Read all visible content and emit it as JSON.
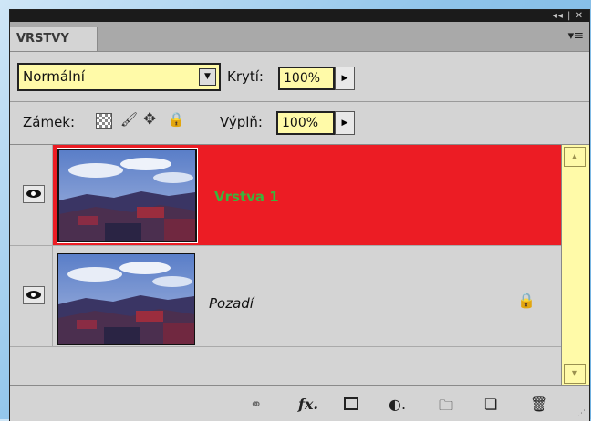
{
  "titlebar": {
    "controls": "◂◂ | ✕"
  },
  "panel": {
    "tab_label": "VRSTVY",
    "menu_icon": "panel-menu-icon"
  },
  "options": {
    "blend_mode": "Normální",
    "opacity_label": "Krytí:",
    "opacity_value": "100%",
    "lock_label": "Zámek:",
    "fill_label": "Výplň:",
    "fill_value": "100%"
  },
  "layers": [
    {
      "name": "Vrstva 1",
      "selected": true,
      "visible": true,
      "locked": false
    },
    {
      "name": "Pozadí",
      "selected": false,
      "visible": true,
      "locked": true
    }
  ],
  "colors": {
    "selected_bg": "#ec1c24",
    "selected_name": "#3cb43c",
    "input_bg": "#fffaa8"
  },
  "bottom_icons": [
    "link-icon",
    "fx-icon",
    "mask-icon",
    "adjustment-icon",
    "folder-icon",
    "new-layer-icon",
    "trash-icon"
  ]
}
